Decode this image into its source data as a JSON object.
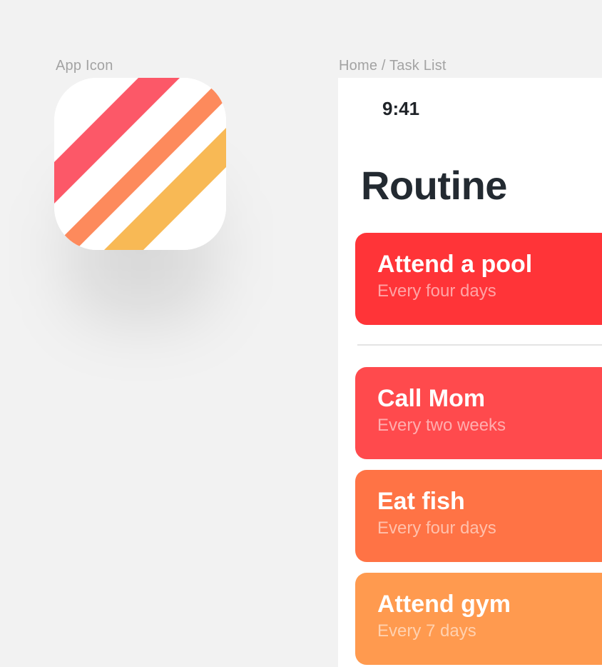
{
  "labels": {
    "app_icon": "App Icon",
    "home": "Home / Task List"
  },
  "app_icon": {
    "stripe_colors": [
      "#fc5868",
      "#fd8a5c",
      "#f8b955"
    ]
  },
  "phone": {
    "status_time": "9:41",
    "title": "Routine",
    "tasks": [
      {
        "title": "Attend a pool",
        "subtitle": "Every four days",
        "color": "#ff3438"
      },
      {
        "title": "Call Mom",
        "subtitle": "Every two weeks",
        "color": "#ff4a4d"
      },
      {
        "title": "Eat fish",
        "subtitle": "Every four days",
        "color": "#ff7345"
      },
      {
        "title": "Attend gym",
        "subtitle": "Every 7 days",
        "color": "#ff9a4f"
      }
    ]
  }
}
